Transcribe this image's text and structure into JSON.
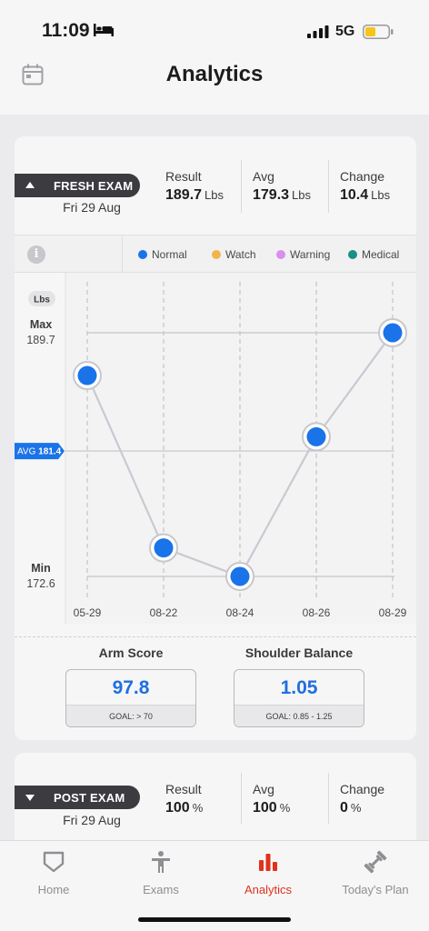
{
  "status_bar": {
    "time": "11:09",
    "network": "5G",
    "icons": [
      "bed-icon",
      "signal-icon",
      "battery-icon"
    ],
    "battery_color": "#f5c518"
  },
  "header": {
    "title": "Analytics",
    "left_icon": "calendar-icon"
  },
  "fresh_exam": {
    "label": "FRESH EXAM",
    "date": "Fri 29 Aug",
    "result_label": "Result",
    "result_value": "189.7",
    "result_unit": "Lbs",
    "avg_label": "Avg",
    "avg_value": "179.3",
    "avg_unit": "Lbs",
    "change_label": "Change",
    "change_value": "10.4",
    "change_unit": "Lbs"
  },
  "legend": {
    "items": [
      {
        "label": "Normal",
        "color": "#1a73e8"
      },
      {
        "label": "Watch",
        "color": "#f0b54a"
      },
      {
        "label": "Warning",
        "color": "#d98ef0"
      },
      {
        "label": "Medical",
        "color": "#1a8f86"
      }
    ]
  },
  "chart_data": {
    "type": "line",
    "unit_label": "Lbs",
    "max_label": "Max",
    "max_value": "189.7",
    "min_label": "Min",
    "min_value": "172.6",
    "avg_label": "AVG",
    "avg_value": "181.4",
    "categories": [
      "05-29",
      "08-22",
      "08-24",
      "08-26",
      "08-29"
    ],
    "values": [
      186.7,
      174.6,
      172.6,
      182.4,
      189.7
    ],
    "ylim": [
      172.6,
      189.7
    ],
    "status": [
      "Normal",
      "Normal",
      "Normal",
      "Normal",
      "Normal"
    ],
    "line_color": "#c9c9d2",
    "point_color": "#1a73e8"
  },
  "scores": {
    "arm_title": "Arm Score",
    "arm_value": "97.8",
    "arm_goal": "GOAL: > 70",
    "shoulder_title": "Shoulder Balance",
    "shoulder_value": "1.05",
    "shoulder_goal": "GOAL: 0.85 - 1.25"
  },
  "post_exam": {
    "label": "POST EXAM",
    "date": "Fri 29 Aug",
    "result_label": "Result",
    "result_value": "100",
    "result_unit": "%",
    "avg_label": "Avg",
    "avg_value": "100",
    "avg_unit": "%",
    "change_label": "Change",
    "change_value": "0",
    "change_unit": "%"
  },
  "tabs": [
    {
      "label": "Home",
      "icon": "home-icon",
      "active": false
    },
    {
      "label": "Exams",
      "icon": "person-icon",
      "active": false
    },
    {
      "label": "Analytics",
      "icon": "bar-chart-icon",
      "active": true
    },
    {
      "label": "Today's Plan",
      "icon": "dumbbell-icon",
      "active": false
    }
  ],
  "accent_color": "#e0321c"
}
